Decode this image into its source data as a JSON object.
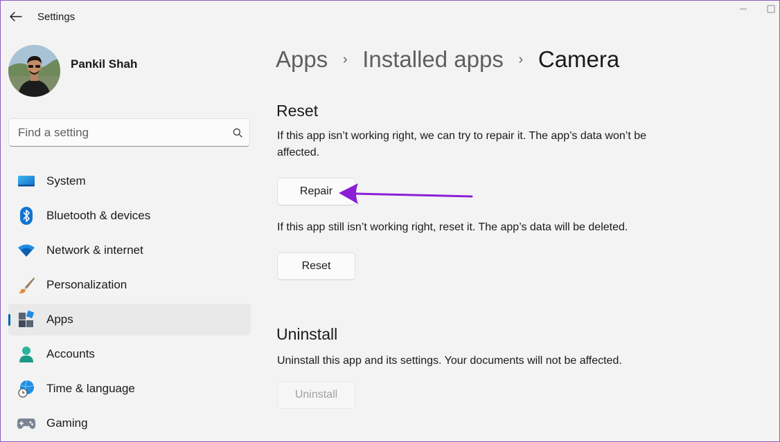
{
  "window": {
    "title": "Settings"
  },
  "profile": {
    "name": "Pankil Shah"
  },
  "search": {
    "placeholder": "Find a setting"
  },
  "nav": {
    "items": [
      {
        "label": "System",
        "icon": "monitor-icon"
      },
      {
        "label": "Bluetooth & devices",
        "icon": "bluetooth-icon"
      },
      {
        "label": "Network & internet",
        "icon": "wifi-icon"
      },
      {
        "label": "Personalization",
        "icon": "paintbrush-icon"
      },
      {
        "label": "Apps",
        "icon": "apps-icon",
        "active": true
      },
      {
        "label": "Accounts",
        "icon": "person-icon"
      },
      {
        "label": "Time & language",
        "icon": "globe-clock-icon"
      },
      {
        "label": "Gaming",
        "icon": "gamepad-icon"
      }
    ]
  },
  "breadcrumb": [
    "Apps",
    "Installed apps",
    "Camera"
  ],
  "reset_section": {
    "title": "Reset",
    "repair_desc": "If this app isn’t working right, we can try to repair it. The app’s data won’t be affected.",
    "repair_button": "Repair",
    "reset_desc": "If this app still isn’t working right, reset it. The app’s data will be deleted.",
    "reset_button": "Reset"
  },
  "uninstall_section": {
    "title": "Uninstall",
    "desc": "Uninstall this app and its settings. Your documents will not be affected.",
    "uninstall_button": "Uninstall"
  },
  "colors": {
    "accent": "#005fb8",
    "annotation_arrow": "#8a1fd6",
    "window_border": "#8a5cc4"
  }
}
